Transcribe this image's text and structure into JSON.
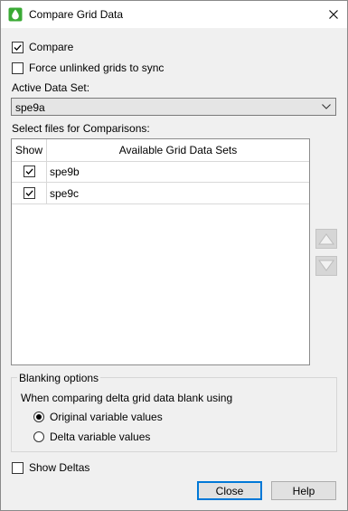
{
  "window": {
    "title": "Compare Grid Data"
  },
  "options": {
    "compare_label": "Compare",
    "compare_checked": true,
    "force_sync_label": "Force unlinked grids to sync",
    "force_sync_checked": false
  },
  "active_data_set": {
    "label": "Active Data Set:",
    "value": "spe9a"
  },
  "files": {
    "label": "Select files for Comparisons:",
    "columns": [
      "Show",
      "Available Grid Data Sets"
    ],
    "rows": [
      {
        "show": true,
        "name": "spe9b"
      },
      {
        "show": true,
        "name": "spe9c"
      }
    ]
  },
  "blanking": {
    "title": "Blanking options",
    "description": "When comparing delta grid data blank using",
    "options": [
      "Original variable values",
      "Delta variable values"
    ],
    "selected": 0
  },
  "show_deltas": {
    "label": "Show Deltas",
    "checked": false
  },
  "buttons": {
    "close": "Close",
    "help": "Help"
  },
  "colors": {
    "accent": "#0078d7",
    "icon_green": "#3aaa35"
  }
}
